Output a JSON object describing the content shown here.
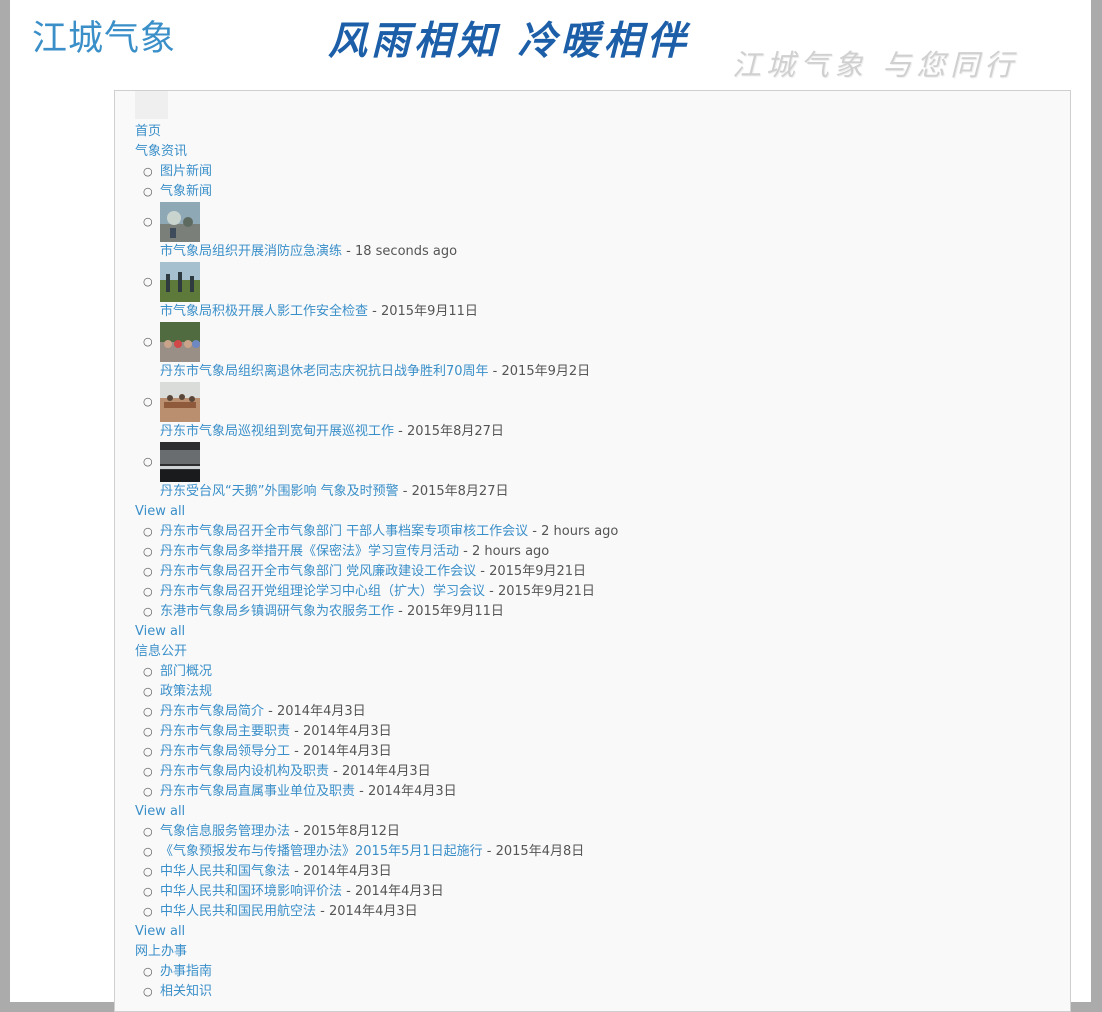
{
  "header": {
    "site_name": "江城气象",
    "slogan_main": "风雨相知 冷暖相伴",
    "slogan_sub": "江城气象 与您同行"
  },
  "nav": {
    "home": "首页",
    "news": {
      "label": "气象资讯",
      "sub1": "图片新闻",
      "sub2": "气象新闻",
      "photo_items": [
        {
          "title": "市气象局组织开展消防应急演练",
          "date": "18 seconds ago"
        },
        {
          "title": "市气象局积极开展人影工作安全检查",
          "date": "2015年9月11日"
        },
        {
          "title": "丹东市气象局组织离退休老同志庆祝抗日战争胜利70周年",
          "date": "2015年9月2日"
        },
        {
          "title": "丹东市气象局巡视组到宽甸开展巡视工作",
          "date": "2015年8月27日"
        },
        {
          "title": "丹东受台风“天鹅”外围影响 气象及时预警",
          "date": "2015年8月27日"
        }
      ],
      "view_all_1": "View all",
      "news_items": [
        {
          "title": "丹东市气象局召开全市气象部门 干部人事档案专项审核工作会议",
          "date": "2 hours ago"
        },
        {
          "title": "丹东市气象局多举措开展《保密法》学习宣传月活动",
          "date": "2 hours ago"
        },
        {
          "title": "丹东市气象局召开全市气象部门 党风廉政建设工作会议",
          "date": "2015年9月21日"
        },
        {
          "title": "丹东市气象局召开党组理论学习中心组（扩大）学习会议",
          "date": "2015年9月21日"
        },
        {
          "title": "东港市气象局乡镇调研气象为农服务工作",
          "date": "2015年9月11日"
        }
      ],
      "view_all_2": "View all"
    },
    "info": {
      "label": "信息公开",
      "sub1": "部门概况",
      "sub2": "政策法规",
      "dept_items": [
        {
          "title": "丹东市气象局简介",
          "date": "2014年4月3日"
        },
        {
          "title": "丹东市气象局主要职责",
          "date": "2014年4月3日"
        },
        {
          "title": "丹东市气象局领导分工",
          "date": "2014年4月3日"
        },
        {
          "title": "丹东市气象局内设机构及职责",
          "date": "2014年4月3日"
        },
        {
          "title": "丹东市气象局直属事业单位及职责",
          "date": "2014年4月3日"
        }
      ],
      "view_all_1": "View all",
      "law_items": [
        {
          "title": "气象信息服务管理办法",
          "date": "2015年8月12日"
        },
        {
          "title": "《气象预报发布与传播管理办法》2015年5月1日起施行",
          "date": "2015年4月8日"
        },
        {
          "title": "中华人民共和国气象法",
          "date": "2014年4月3日"
        },
        {
          "title": "中华人民共和国环境影响评价法",
          "date": "2014年4月3日"
        },
        {
          "title": "中华人民共和国民用航空法",
          "date": "2014年4月3日"
        }
      ],
      "view_all_2": "View all"
    },
    "online": {
      "label": "网上办事",
      "sub1": "办事指南",
      "sub2": "相关知识"
    }
  },
  "colors": {
    "link": "#3a8fc9",
    "slogan": "#1c5fa8",
    "page_bg": "#ababab"
  }
}
